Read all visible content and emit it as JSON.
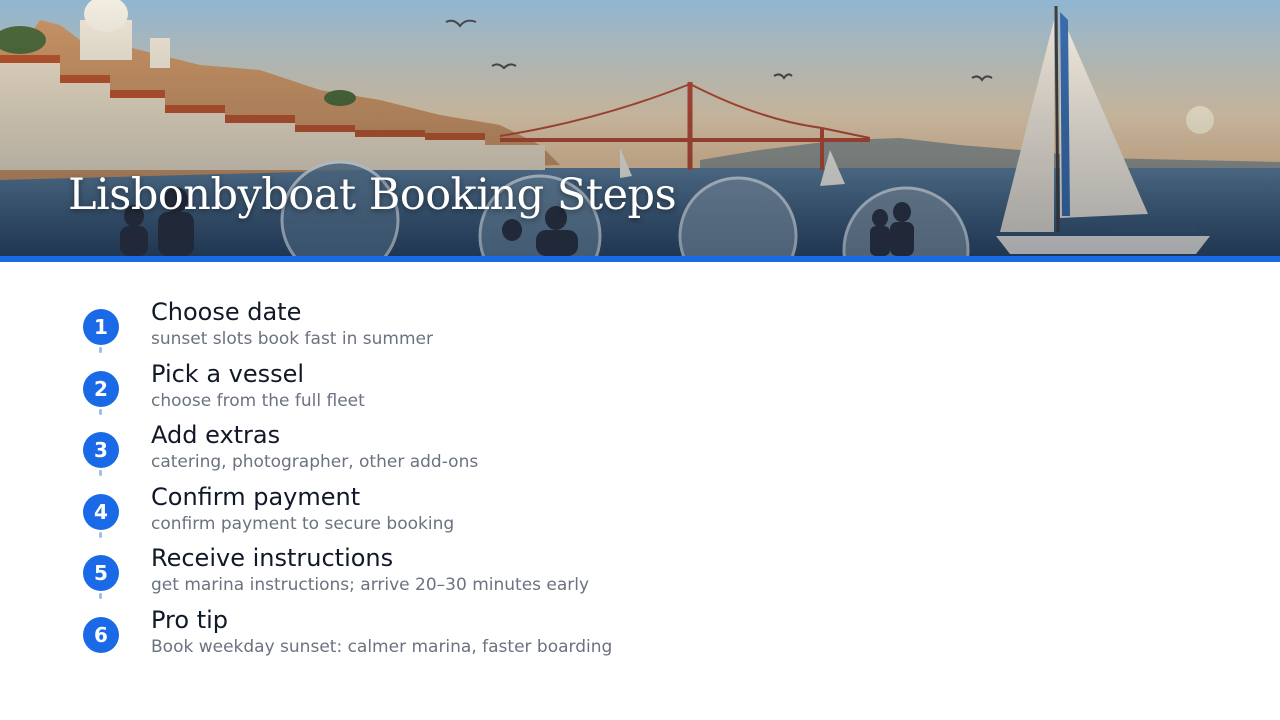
{
  "header": {
    "title": "Lisbonbyboat Booking Steps",
    "accent_color": "#1a6ae8"
  },
  "steps": [
    {
      "number": "1",
      "title": "Choose date",
      "description": "sunset slots book fast in summer"
    },
    {
      "number": "2",
      "title": "Pick a vessel",
      "description": "choose from the full fleet"
    },
    {
      "number": "3",
      "title": "Add extras",
      "description": "catering, photographer, other add-ons"
    },
    {
      "number": "4",
      "title": "Confirm payment",
      "description": "confirm payment to secure booking"
    },
    {
      "number": "5",
      "title": "Receive instructions",
      "description": "get marina instructions; arrive 20–30 minutes early"
    },
    {
      "number": "6",
      "title": "Pro tip",
      "description": "Book weekday sunset: calmer marina, faster boarding"
    }
  ]
}
